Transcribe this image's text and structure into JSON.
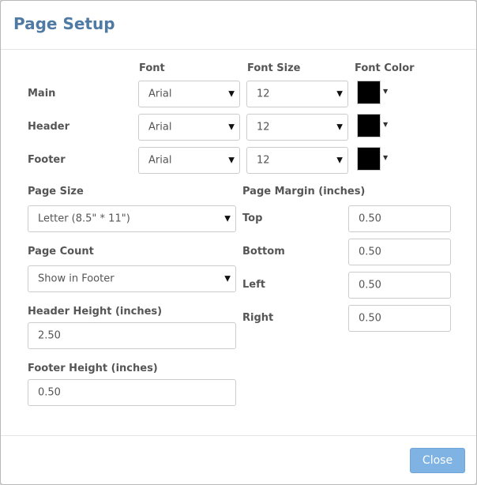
{
  "dialog": {
    "title": "Page Setup"
  },
  "font_table": {
    "columns": {
      "font": "Font",
      "font_size": "Font Size",
      "font_color": "Font Color"
    },
    "rows": [
      {
        "label": "Main",
        "font": "Arial",
        "size": "12",
        "color": "#000000"
      },
      {
        "label": "Header",
        "font": "Arial",
        "size": "12",
        "color": "#000000"
      },
      {
        "label": "Footer",
        "font": "Arial",
        "size": "12",
        "color": "#000000"
      }
    ]
  },
  "page_size": {
    "label": "Page Size",
    "value": "Letter (8.5\" * 11\")"
  },
  "page_count": {
    "label": "Page Count",
    "value": "Show in Footer"
  },
  "header_height": {
    "label": "Header Height (inches)",
    "value": "2.50"
  },
  "footer_height": {
    "label": "Footer Height (inches)",
    "value": "0.50"
  },
  "page_margin": {
    "label": "Page Margin (inches)",
    "top_label": "Top",
    "top_value": "0.50",
    "bottom_label": "Bottom",
    "bottom_value": "0.50",
    "left_label": "Left",
    "left_value": "0.50",
    "right_label": "Right",
    "right_value": "0.50"
  },
  "buttons": {
    "close": "Close"
  },
  "icons": {
    "dropdown": "dropdown-caret-icon"
  },
  "colors": {
    "title": "#4f7aa3",
    "primary_button": "#7fb3e4"
  }
}
